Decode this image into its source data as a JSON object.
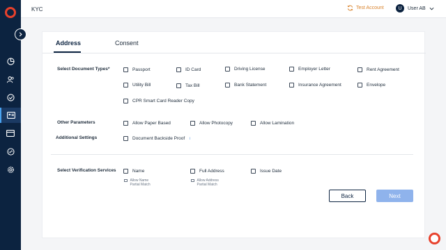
{
  "topbar": {
    "title": "KYC",
    "test_account": "Test Account",
    "user_initial": "U",
    "user_name": "User AB"
  },
  "tabs": [
    {
      "label": "Address"
    },
    {
      "label": "Consent"
    }
  ],
  "document_types": {
    "label": "Select Document Types*",
    "options": [
      "Passport",
      "ID Card",
      "Driving License",
      "Employer Letter",
      "Rent Agreement",
      "Utility Bill",
      "Tax Bill",
      "Bank Statement",
      "Insurance Agreement",
      "Envelope",
      "CPR Smart Card Reader Copy"
    ]
  },
  "other_parameters": {
    "label": "Other Parameters",
    "options": [
      "Allow Paper Based",
      "Allow Photocopy",
      "Allow Lamination"
    ]
  },
  "additional_settings": {
    "label": "Additional Settings",
    "option": "Document Backside Proof",
    "info": "i"
  },
  "verification_services": {
    "label": "Select Verification Services",
    "options": [
      "Name",
      "Full Address",
      "Issue Date"
    ],
    "sub_options": [
      "Allow Name Partial Match",
      "Allow Address Partial Match"
    ]
  },
  "buttons": {
    "back": "Back",
    "next": "Next"
  }
}
